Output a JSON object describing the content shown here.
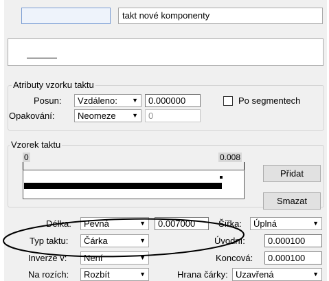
{
  "top": {
    "field_value": "",
    "component_name": "takt nové komponenty"
  },
  "sample_group": {
    "title": "Atributy vzorku taktu",
    "posun_label": "Posun:",
    "posun_value": "Vzdáleno:",
    "posun_amount": "0.000000",
    "opakovani_label": "Opakování:",
    "opakovani_value": "Neomeze",
    "opakovani_amount": "0",
    "po_segmentech_label": "Po segmentech",
    "po_segmentech_checked": false
  },
  "pattern_group": {
    "title": "Vzorek taktu",
    "ruler_start": "0",
    "ruler_end": "0.008",
    "add_button": "Přidat",
    "delete_button": "Smazat",
    "dash_length_fraction": 0.9
  },
  "attributes": {
    "delka_label": "Délka:",
    "delka_value": "Pevná",
    "delka_amount": "0.007000",
    "sirka_label": "Šířka:",
    "sirka_value": "Úplná",
    "typ_label": "Typ taktu:",
    "typ_value": "Čárka",
    "uvodni_label": "Úvodní:",
    "uvodni_value": "0.000100",
    "inverze_label": "Inverze v:",
    "inverze_value": "Není",
    "koncova_label": "Koncová:",
    "koncova_value": "0.000100",
    "rozich_label": "Na rozích:",
    "rozich_value": "Rozbít",
    "hrana_label": "Hrana čárky:",
    "hrana_value": "Uzavřená"
  }
}
